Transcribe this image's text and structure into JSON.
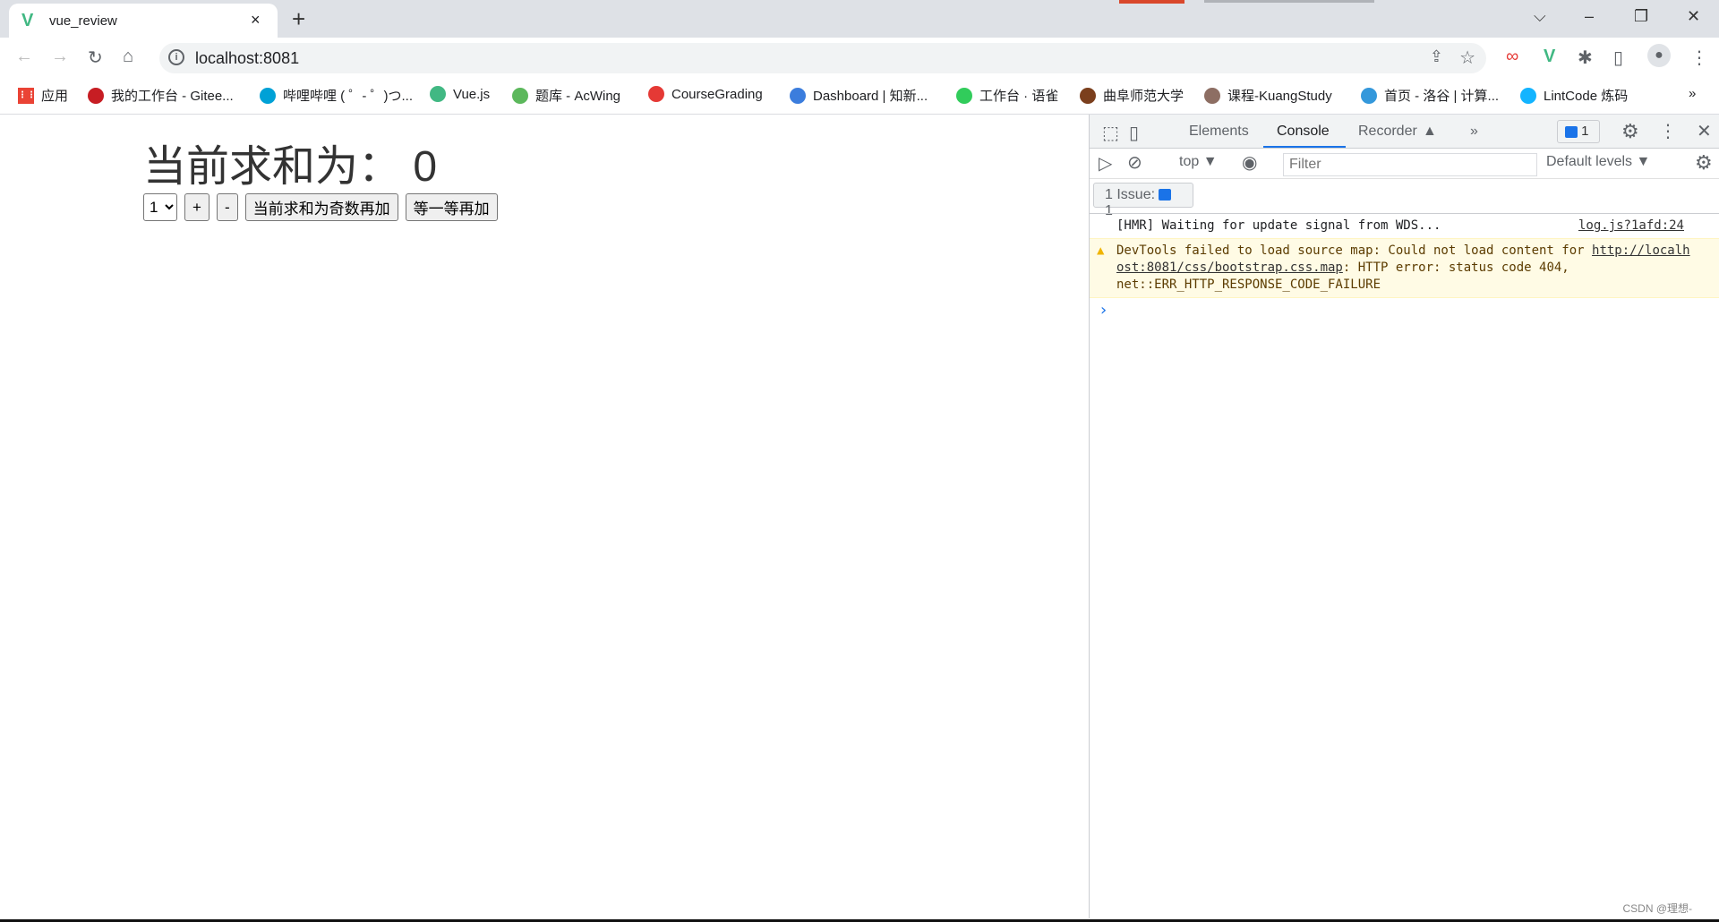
{
  "browser": {
    "tab": {
      "title": "vue_review",
      "favicon": "vue-logo-icon",
      "close": "×"
    },
    "new_tab": "+",
    "window_controls": {
      "dropdown": "⌵",
      "minimize": "–",
      "restore": "❐",
      "close": "✕"
    },
    "nav": {
      "back": "←",
      "forward": "→",
      "reload": "↻",
      "home": "⌂"
    },
    "url": "localhost:8081",
    "bookmarks": [
      {
        "label": "应用",
        "icon": "apps-grid-icon",
        "color": "#ea4335"
      },
      {
        "label": "我的工作台 - Gitee...",
        "icon": "gitee-icon",
        "color": "#c71d23"
      },
      {
        "label": "哔哩哔哩 ( ゜- ゜)つ...",
        "icon": "bilibili-icon",
        "color": "#00a1d6"
      },
      {
        "label": "Vue.js",
        "icon": "vue-icon",
        "color": "#41b883"
      },
      {
        "label": "题库 - AcWing",
        "icon": "acwing-icon",
        "color": "#5cb85c"
      },
      {
        "label": "CourseGrading",
        "icon": "coursegrading-icon",
        "color": "#e53935"
      },
      {
        "label": "Dashboard | 知新...",
        "icon": "zhixin-icon",
        "color": "#3b7ddd"
      },
      {
        "label": "工作台 · 语雀",
        "icon": "yuque-icon",
        "color": "#31cc5b"
      },
      {
        "label": "曲阜师范大学",
        "icon": "university-icon",
        "color": "#7b3f1d"
      },
      {
        "label": "课程-KuangStudy",
        "icon": "kuangstudy-icon",
        "color": "#8d6e63"
      },
      {
        "label": "首页 - 洛谷 | 计算...",
        "icon": "luogu-icon",
        "color": "#3498db"
      },
      {
        "label": "LintCode 炼码",
        "icon": "lintcode-icon",
        "color": "#13b4ff"
      }
    ],
    "bookmarks_more": "»"
  },
  "app": {
    "heading": "当前求和为：  0",
    "select_value": "1",
    "buttons": [
      "+",
      "-",
      "当前求和为奇数再加",
      "等一等再加"
    ]
  },
  "devtools": {
    "tabs": [
      "Elements",
      "Console",
      "Recorder"
    ],
    "active_tab": "Console",
    "more_tabs": "»",
    "issues_badge": "1",
    "context": "top ▼",
    "filter_placeholder": "Filter",
    "levels": "Default levels ▼",
    "issue_bar": {
      "label": "1 Issue:",
      "count": "1"
    },
    "messages": [
      {
        "text": "[HMR] Waiting for update signal from WDS...",
        "source": "log.js?1afd:24"
      },
      {
        "pre": "DevTools failed to load source map: Could not load content for ",
        "link": "http://localhost:8081/css/bootstrap.css.map",
        "post": ": HTTP error: status code 404, net::ERR_HTTP_RESPONSE_CODE_FAILURE",
        "level": "warning"
      }
    ],
    "prompt": "›"
  },
  "watermark": "CSDN @理想-"
}
